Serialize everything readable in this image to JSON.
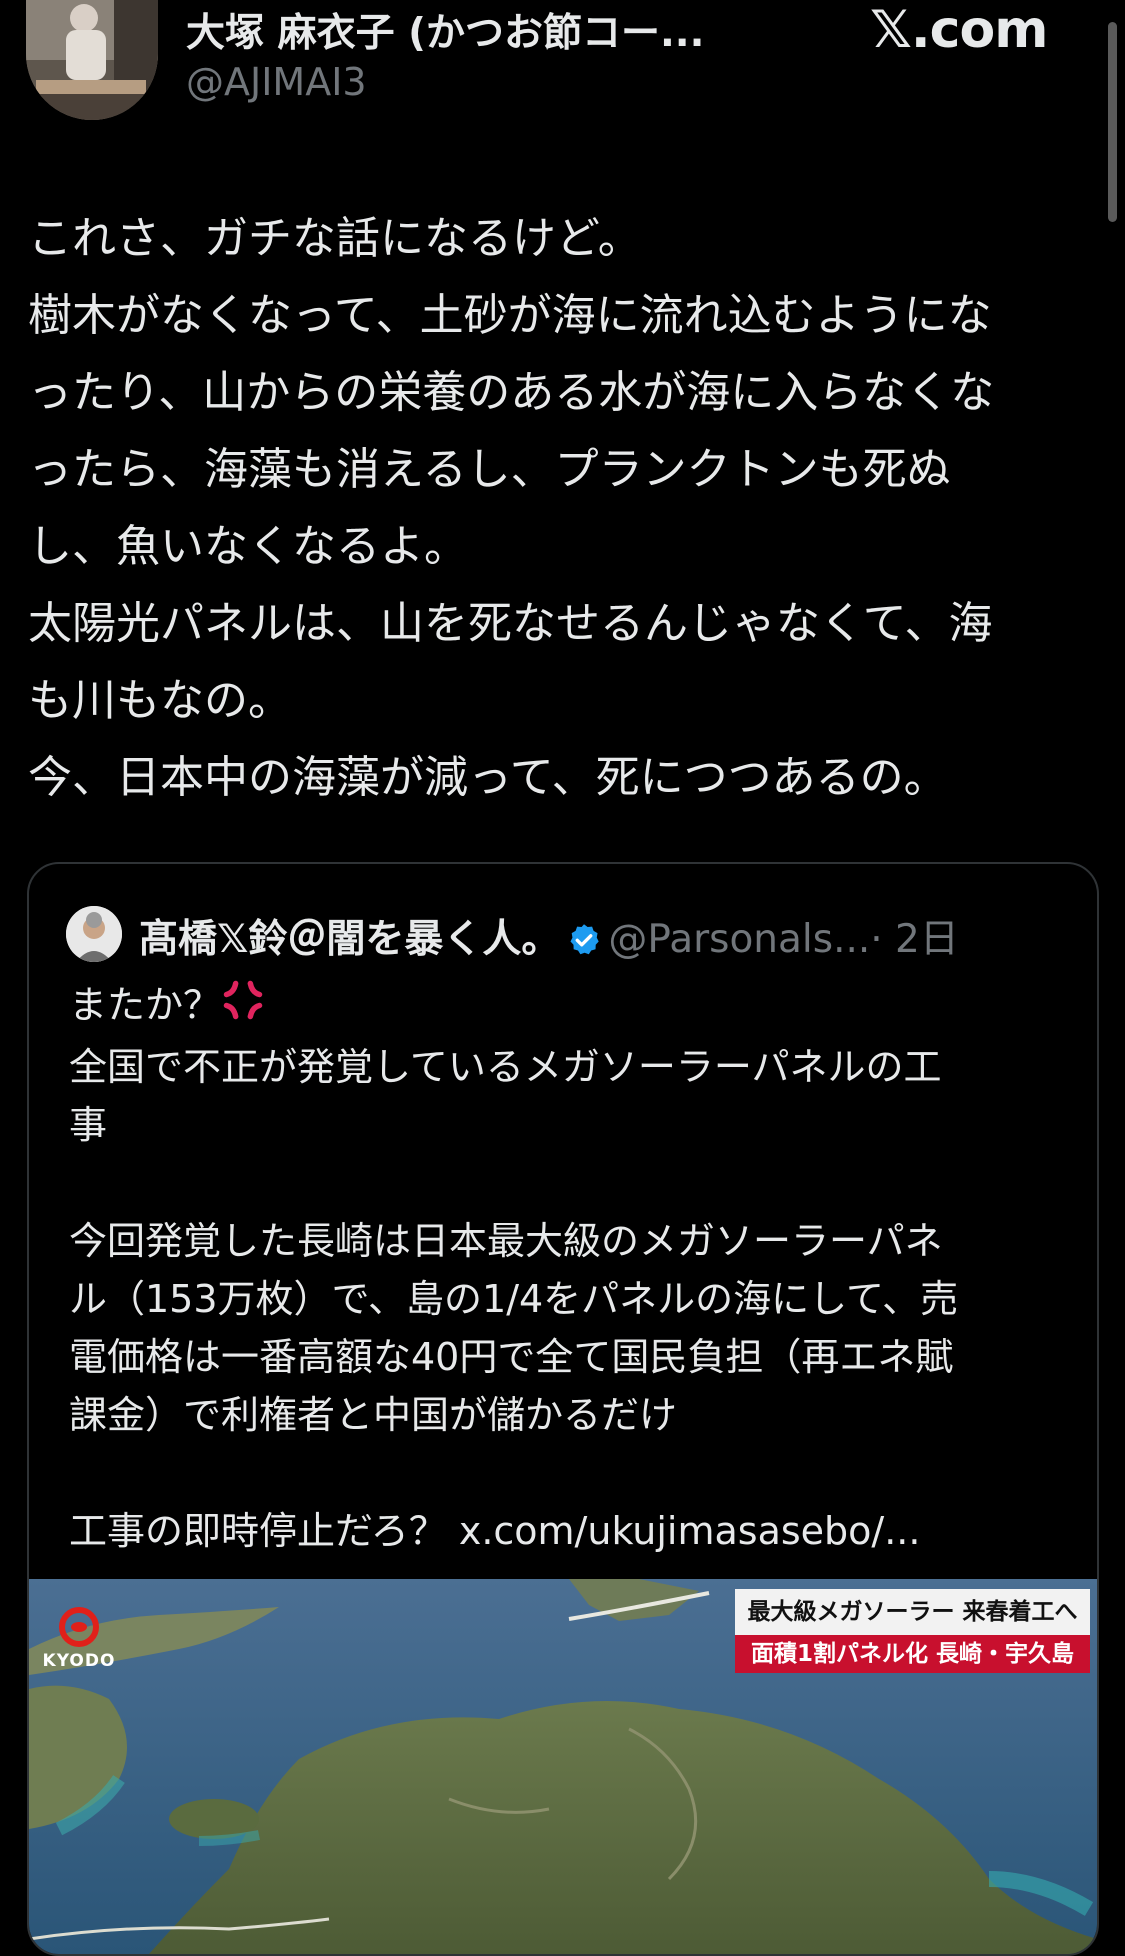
{
  "header": {
    "author_name": "大塚 麻衣子 (かつお節コー...",
    "author_handle": "@AJIMAI3",
    "site": "𝕏.com"
  },
  "post": {
    "lines": [
      "これさ、ガチな話になるけど。",
      "樹木がなくなって、土砂が海に流れ込むようにな",
      "ったり、山からの栄養のある水が海に入らなくな",
      "ったら、海藻も消えるし、プランクトンも死ぬ",
      "し、魚いなくなるよ。",
      "太陽光パネルは、山を死なせるんじゃなくて、海",
      "も川もなの。",
      "今、日本中の海藻が減って、死につつあるの。"
    ]
  },
  "quote": {
    "name": "髙橋𝕏鈴＠闇を暴く人。",
    "handle": "@Parsonals...",
    "time": "· 2日",
    "lines": [
      "またか？",
      "全国で不正が発覚しているメガソーラーパネルの工",
      "事",
      "",
      "今回発覚した長崎は日本最大級のメガソーラーパネ",
      "ル（153万枚）で、島の1/4をパネルの海にして、売",
      "電価格は一番高額な40円で全て国民負担（再エネ賦",
      "課金）で利権者と中国が儲かるだけ",
      "",
      "工事の即時停止だろ？"
    ],
    "link": "x.com/ukujimasasebo/...",
    "media": {
      "logo_text": "KYODO",
      "caption_top": "最大級メガソーラー 来春着工へ",
      "caption_bottom": "面積1割パネル化 長崎・宇久島"
    }
  },
  "colors": {
    "background": "#000000",
    "text": "#e7e9ea",
    "secondary": "#71767b",
    "verified": "#1d9bf0",
    "border": "#2f3336",
    "caption_red": "#c8102e"
  },
  "icons": [
    "verified-badge-icon",
    "anger-symbol-icon",
    "kyodo-logo-icon"
  ]
}
